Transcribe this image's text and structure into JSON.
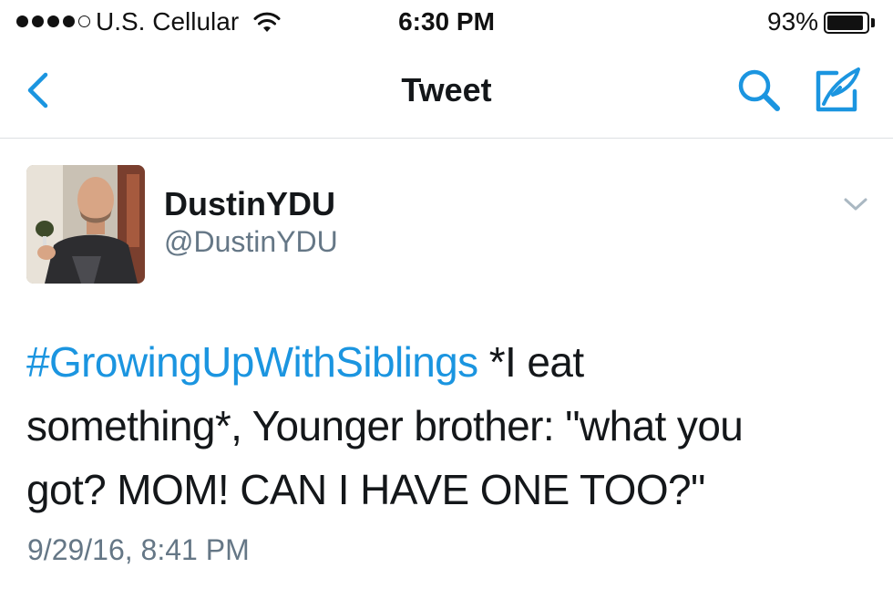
{
  "status_bar": {
    "carrier": "U.S. Cellular",
    "time": "6:30 PM",
    "battery_percent": "93%",
    "battery_level": 0.93,
    "signal_bars_filled": 4,
    "signal_bars_total": 5
  },
  "nav": {
    "title": "Tweet",
    "back_icon": "chevron-left-icon",
    "search_icon": "search-icon",
    "compose_icon": "compose-icon"
  },
  "tweet": {
    "display_name": "DustinYDU",
    "handle": "@DustinYDU",
    "hashtag": "#GrowingUpWithSiblings",
    "text_line1_rest": " *I eat",
    "text_line2": "something*, Younger brother: \"what you",
    "text_line3": "got? MOM! CAN I HAVE ONE TOO?\"",
    "timestamp": "9/29/16, 8:41 PM"
  },
  "colors": {
    "accent": "#1b95e0",
    "text": "#14171a",
    "secondary": "#657786"
  }
}
